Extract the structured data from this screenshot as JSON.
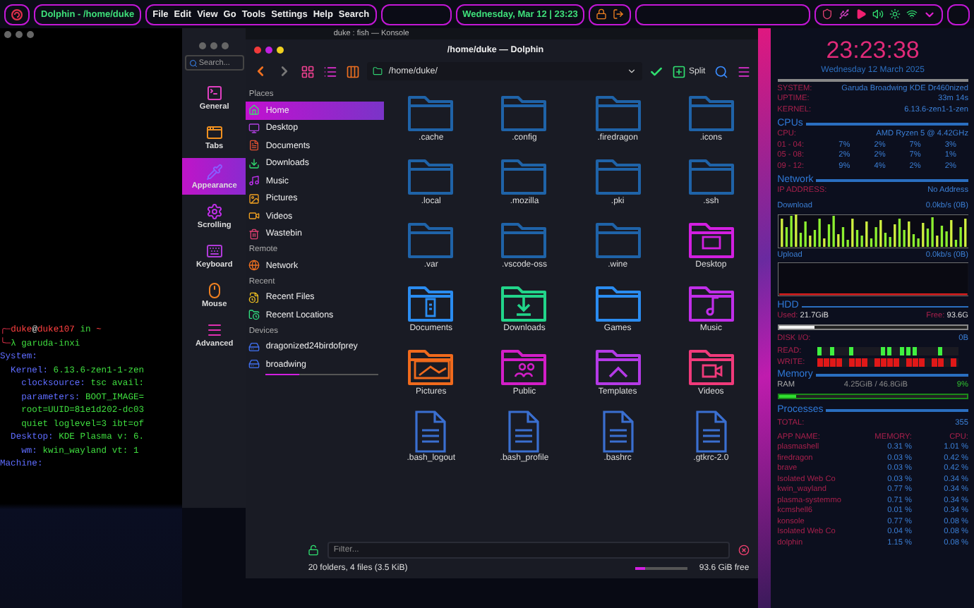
{
  "topbar": {
    "window_title": "Dolphin - /home/duke",
    "menus": [
      "File",
      "Edit",
      "View",
      "Go",
      "Tools",
      "Settings",
      "Help",
      "Search"
    ],
    "datetime": "Wednesday, Mar 12 | 23:23"
  },
  "terminal": {
    "title": "duke : fish — Konsole",
    "lines": [
      {
        "parts": [
          {
            "kind": "corner",
            "text": "╭─"
          },
          {
            "kind": "user",
            "text": "duke"
          },
          {
            "kind": "plain",
            "text": "@"
          },
          {
            "kind": "user",
            "text": "duke107"
          },
          {
            "kind": "value",
            "text": " in "
          },
          {
            "kind": "user",
            "text": "~"
          }
        ]
      },
      {
        "parts": [
          {
            "kind": "corner",
            "text": "╰─"
          },
          {
            "kind": "value",
            "text": "λ garuda-inxi"
          }
        ]
      },
      {
        "parts": [
          {
            "kind": "key",
            "text": "System:"
          }
        ]
      },
      {
        "parts": [
          {
            "kind": "key",
            "text": "  Kernel: "
          },
          {
            "kind": "value",
            "text": "6.13.6-zen1-1-zen"
          }
        ]
      },
      {
        "parts": [
          {
            "kind": "key",
            "text": "    clocksource: "
          },
          {
            "kind": "value",
            "text": "tsc avail:"
          }
        ]
      },
      {
        "parts": [
          {
            "kind": "key",
            "text": "    parameters: "
          },
          {
            "kind": "value",
            "text": "BOOT_IMAGE="
          }
        ]
      },
      {
        "parts": [
          {
            "kind": "value",
            "text": "    root=UUID=81e1d202-dc03"
          }
        ]
      },
      {
        "parts": [
          {
            "kind": "value",
            "text": "    quiet loglevel=3 ibt=of"
          }
        ]
      },
      {
        "parts": [
          {
            "kind": "key",
            "text": "  Desktop: "
          },
          {
            "kind": "value",
            "text": "KDE Plasma v: 6."
          }
        ]
      },
      {
        "parts": [
          {
            "kind": "key",
            "text": "    wm: "
          },
          {
            "kind": "value",
            "text": "kwin_wayland vt: 1"
          }
        ]
      },
      {
        "parts": [
          {
            "kind": "key",
            "text": "Machine:"
          }
        ]
      }
    ]
  },
  "settings": {
    "search_placeholder": "Search...",
    "items": [
      {
        "label": "General",
        "kind": "terminal",
        "selected": false
      },
      {
        "label": "Tabs",
        "kind": "tabs",
        "selected": false
      },
      {
        "label": "Appearance",
        "kind": "pipette",
        "selected": true
      },
      {
        "label": "Scrolling",
        "kind": "gear",
        "selected": false
      },
      {
        "label": "Keyboard",
        "kind": "keyboard",
        "selected": false
      },
      {
        "label": "Mouse",
        "kind": "mouse",
        "selected": false
      },
      {
        "label": "Advanced",
        "kind": "lines",
        "selected": false
      }
    ]
  },
  "dolphin": {
    "title": "/home/duke — Dolphin",
    "path": "/home/duke/",
    "split_label": "Split",
    "places": [
      {
        "heading": "Places",
        "items": [
          {
            "label": "Home",
            "kind": "home",
            "selected": true
          },
          {
            "label": "Desktop",
            "kind": "desktop",
            "selected": false
          },
          {
            "label": "Documents",
            "kind": "documents",
            "selected": false
          },
          {
            "label": "Downloads",
            "kind": "downloads",
            "selected": false
          },
          {
            "label": "Music",
            "kind": "music",
            "selected": false
          },
          {
            "label": "Pictures",
            "kind": "pictures",
            "selected": false
          },
          {
            "label": "Videos",
            "kind": "videos",
            "selected": false
          },
          {
            "label": "Wastebin",
            "kind": "trash",
            "selected": false
          }
        ]
      },
      {
        "heading": "Remote",
        "items": [
          {
            "label": "Network",
            "kind": "network",
            "selected": false
          }
        ]
      },
      {
        "heading": "Recent",
        "items": [
          {
            "label": "Recent Files",
            "kind": "recent-files",
            "selected": false
          },
          {
            "label": "Recent Locations",
            "kind": "recent-locations",
            "selected": false
          }
        ]
      },
      {
        "heading": "Devices",
        "items": [
          {
            "label": "dragonized24birdofprey",
            "kind": "drive",
            "selected": false
          },
          {
            "label": "broadwing",
            "kind": "drive",
            "selected": false,
            "level": 0.3
          }
        ]
      }
    ],
    "files": [
      {
        "name": ".cache",
        "kind": "folder",
        "color": "#1f63a8"
      },
      {
        "name": ".config",
        "kind": "folder",
        "color": "#1f63a8"
      },
      {
        "name": ".firedragon",
        "kind": "folder",
        "color": "#1f63a8"
      },
      {
        "name": ".icons",
        "kind": "folder",
        "color": "#1f63a8"
      },
      {
        "name": ".local",
        "kind": "folder",
        "color": "#1f63a8"
      },
      {
        "name": ".mozilla",
        "kind": "folder",
        "color": "#1f63a8"
      },
      {
        "name": ".pki",
        "kind": "folder",
        "color": "#1f63a8"
      },
      {
        "name": ".ssh",
        "kind": "folder",
        "color": "#1f63a8"
      },
      {
        "name": ".var",
        "kind": "folder",
        "color": "#1f63a8"
      },
      {
        "name": ".vscode-oss",
        "kind": "folder",
        "color": "#1f63a8"
      },
      {
        "name": ".wine",
        "kind": "folder",
        "color": "#1f63a8"
      },
      {
        "name": "Desktop",
        "kind": "desktop",
        "color": "#d21fe0"
      },
      {
        "name": "Documents",
        "kind": "documents",
        "color": "#2a8cf0"
      },
      {
        "name": "Downloads",
        "kind": "downloads",
        "color": "#22d58a"
      },
      {
        "name": "Games",
        "kind": "folder",
        "color": "#2a8cf0"
      },
      {
        "name": "Music",
        "kind": "music",
        "color": "#c02ee8"
      },
      {
        "name": "Pictures",
        "kind": "pictures",
        "color": "#f06a1c"
      },
      {
        "name": "Public",
        "kind": "public",
        "color": "#d31ec8"
      },
      {
        "name": "Templates",
        "kind": "templates",
        "color": "#b43ae6"
      },
      {
        "name": "Videos",
        "kind": "videos",
        "color": "#f03a7a"
      },
      {
        "name": ".bash_logout",
        "kind": "file",
        "color": "#3a6fd0"
      },
      {
        "name": ".bash_profile",
        "kind": "file",
        "color": "#3a6fd0"
      },
      {
        "name": ".bashrc",
        "kind": "file",
        "color": "#3a6fd0"
      },
      {
        "name": ".gtkrc-2.0",
        "kind": "file",
        "color": "#3a6fd0"
      }
    ],
    "filter_placeholder": "Filter...",
    "status": "20 folders, 4 files (3.5 KiB)",
    "free": "93.6 GiB free",
    "free_bar": {
      "level": 0.19
    }
  },
  "conky": {
    "clock": "23:23:38",
    "date": "Wednesday 12 March 2025",
    "system": [
      {
        "label": "SYSTEM:",
        "value": "Garuda Broadwing KDE Dr460nized"
      },
      {
        "label": "UPTIME:",
        "value": "33m 14s"
      },
      {
        "label": "KERNEL:",
        "value": "6.13.6-zen1-1-zen"
      }
    ],
    "cpus_heading": "CPUs",
    "cpu_label": "CPU:",
    "cpu_model": "AMD Ryzen 5 @ 4.42GHz",
    "cpu_rows": [
      {
        "label": "01 - 04:",
        "values": [
          "7%",
          "2%",
          "7%",
          "3%"
        ]
      },
      {
        "label": "05 - 08:",
        "values": [
          "2%",
          "2%",
          "7%",
          "1%"
        ]
      },
      {
        "label": "09 - 12:",
        "values": [
          "9%",
          "4%",
          "2%",
          "2%"
        ]
      }
    ],
    "network_heading": "Network",
    "ip_label": "IP ADDRESS:",
    "ip_value": "No Address",
    "download_label": "Download",
    "download_value": "0.0kb/s (0B)",
    "upload_label": "Upload",
    "upload_value": "0.0kb/s (0B)",
    "hdd_heading": "HDD",
    "used_label": "Used:",
    "used_value": "21.7GiB",
    "free_label": "Free:",
    "free_value": "93.6G",
    "hdd_bar": {
      "level": 0.19
    },
    "disk_io_label": "DISK I/O:",
    "disk_io_value": "0B",
    "read_label": "READ:",
    "write_label": "WRITE:",
    "memory_heading": "Memory",
    "ram_label": "RAM",
    "ram_value": "4.25GiB / 46.8GiB",
    "ram_percent": "9%",
    "ram_bar": {
      "level": 0.09
    },
    "processes_heading": "Processes",
    "total_label": "TOTAL:",
    "total_value": "355",
    "columns": [
      "APP NAME:",
      "MEMORY:",
      "CPU:"
    ],
    "processes": [
      {
        "name": "plasmashell",
        "memory": "0.31 %",
        "cpu": "1.01 %"
      },
      {
        "name": "firedragon",
        "memory": "0.03 %",
        "cpu": "0.42 %"
      },
      {
        "name": "brave",
        "memory": "0.03 %",
        "cpu": "0.42 %"
      },
      {
        "name": "Isolated Web Co",
        "memory": "0.03 %",
        "cpu": "0.34 %"
      },
      {
        "name": "kwin_wayland",
        "memory": "0.77 %",
        "cpu": "0.34 %"
      },
      {
        "name": "plasma-systemmo",
        "memory": "0.71 %",
        "cpu": "0.34 %"
      },
      {
        "name": "kcmshell6",
        "memory": "0.01 %",
        "cpu": "0.34 %"
      },
      {
        "name": "konsole",
        "memory": "0.77 %",
        "cpu": "0.08 %"
      },
      {
        "name": "Isolated Web Co",
        "memory": "0.04 %",
        "cpu": "0.08 %"
      },
      {
        "name": "dolphin",
        "memory": "1.15 %",
        "cpu": "0.08 %"
      }
    ]
  }
}
